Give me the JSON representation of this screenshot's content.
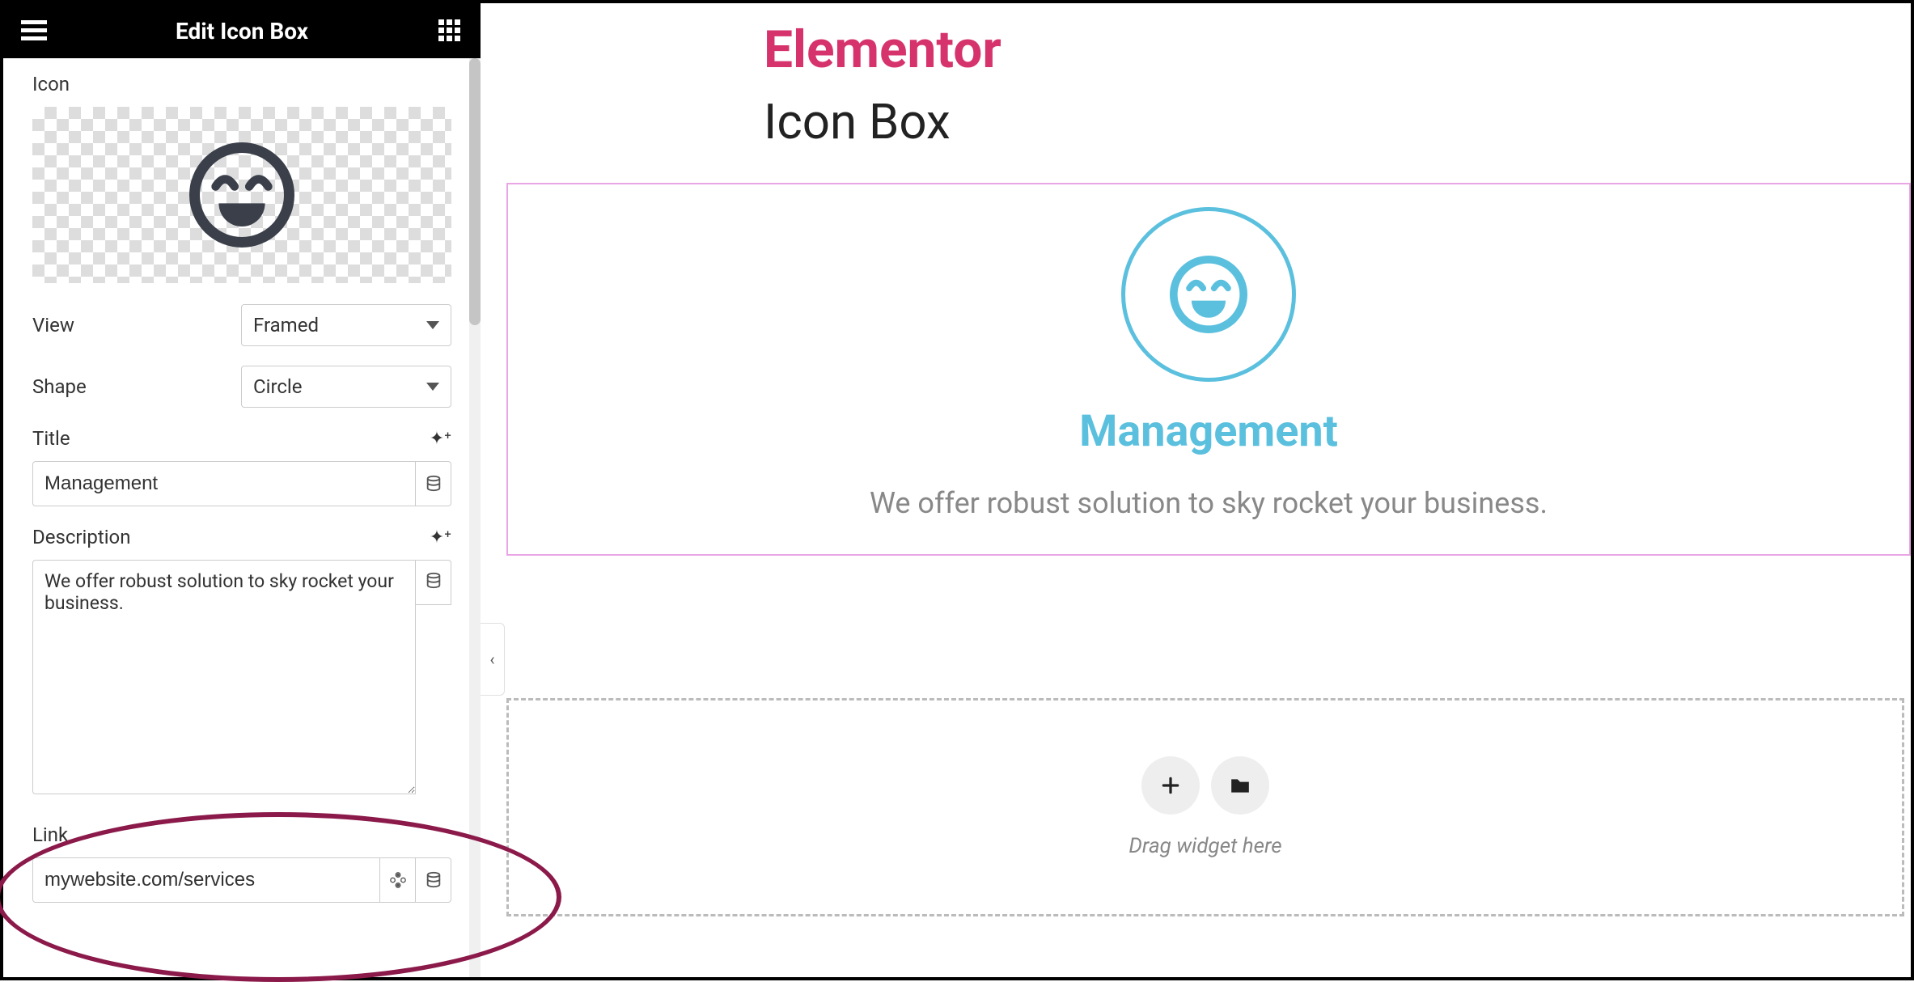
{
  "panel": {
    "title": "Edit Icon Box",
    "icon_label": "Icon",
    "view_label": "View",
    "view_value": "Framed",
    "shape_label": "Shape",
    "shape_value": "Circle",
    "title_label": "Title",
    "title_value": "Management",
    "description_label": "Description",
    "description_value": "We offer robust solution to sky rocket your business.",
    "link_label": "Link",
    "link_value": "mywebsite.com/services"
  },
  "preview": {
    "brand": "Elementor",
    "page_title": "Icon Box",
    "widget_title": "Management",
    "widget_description": "We offer robust solution to sky rocket your business.",
    "dropzone_text": "Drag widget here"
  }
}
